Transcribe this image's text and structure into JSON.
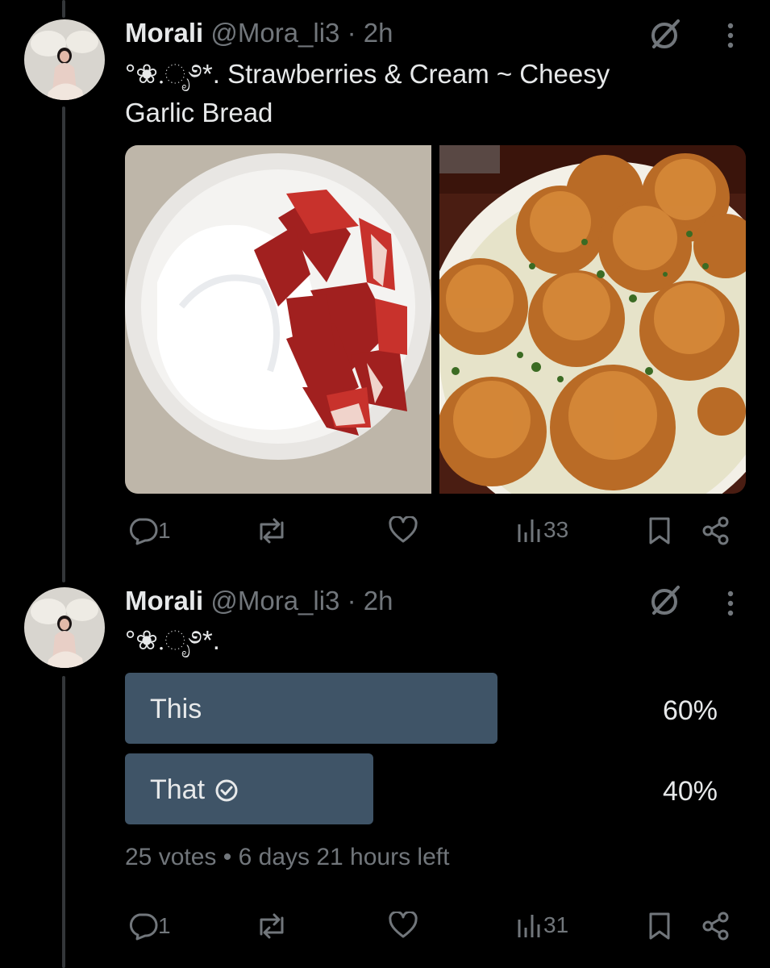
{
  "posts": [
    {
      "author": {
        "name": "Morali",
        "handle": "@Mora_li3",
        "time": "2h"
      },
      "text": "°❀.ೃ࿔*. Strawberries & Cream ~ Cheesy Garlic Bread",
      "media": [
        {
          "name": "strawberries-cream-photo"
        },
        {
          "name": "garlic-bread-photo"
        }
      ],
      "actions": {
        "replies": "1",
        "reposts": "",
        "likes": "",
        "views": "33"
      }
    },
    {
      "author": {
        "name": "Morali",
        "handle": "@Mora_li3",
        "time": "2h"
      },
      "text": "°❀.ೃ࿔*.",
      "poll": {
        "options": [
          {
            "label": "This",
            "percent": "60%",
            "fraction": 0.6
          },
          {
            "label": "That",
            "percent": "40%",
            "fraction": 0.4,
            "selected": true
          }
        ],
        "votes": "25 votes",
        "time_left": "6 days 21 hours left"
      },
      "actions": {
        "replies": "1",
        "reposts": "",
        "likes": "",
        "views": "31"
      }
    }
  ],
  "separator": "·",
  "bullet": "•",
  "colors": {
    "background": "#000000",
    "poll_bar": "#3f5467",
    "muted_text": "#71767b",
    "text": "#e7e9ea"
  },
  "icons": [
    "reply-icon",
    "repost-icon",
    "like-icon",
    "views-icon",
    "bookmark-icon",
    "share-icon",
    "grok-icon",
    "more-icon",
    "vote-check-icon"
  ]
}
